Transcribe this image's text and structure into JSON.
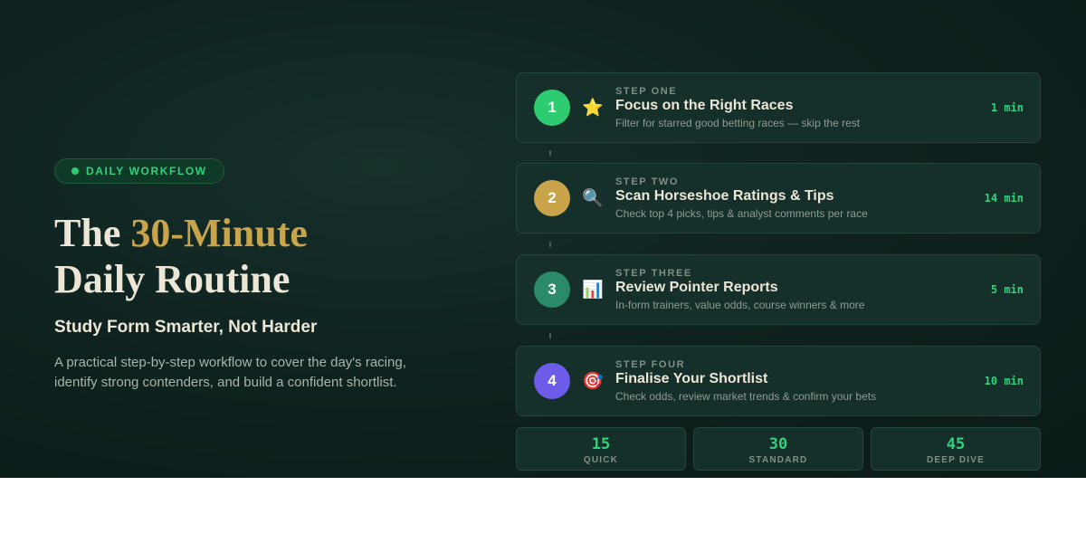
{
  "badge": {
    "label": "DAILY WORKFLOW"
  },
  "hero": {
    "title_pre": "The ",
    "title_accent": "30-Minute",
    "title_line2": "Daily Routine",
    "subtitle": "Study Form Smarter, Not Harder",
    "description": "A practical step-by-step workflow to cover the day's racing, identify strong contenders, and build a confident shortlist."
  },
  "steps": [
    {
      "number": "1",
      "label": "STEP ONE",
      "title": "Focus on the Right Races",
      "description": "Filter for starred good betting races — skip the rest",
      "time": "1 min",
      "icon": "star-icon",
      "emoji": "⭐",
      "color": "#2ecc71"
    },
    {
      "number": "2",
      "label": "STEP TWO",
      "title": "Scan Horseshoe Ratings & Tips",
      "description": "Check top 4 picks, tips & analyst comments per race",
      "time": "14 min",
      "icon": "magnifier-icon",
      "emoji": "🔍",
      "color": "#c9a44a"
    },
    {
      "number": "3",
      "label": "STEP THREE",
      "title": "Review Pointer Reports",
      "description": "In-form trainers, value odds, course winners & more",
      "time": "5 min",
      "icon": "bar-chart-icon",
      "emoji": "📊",
      "color": "#2a8a6a"
    },
    {
      "number": "4",
      "label": "STEP FOUR",
      "title": "Finalise Your Shortlist",
      "description": "Check odds, review market trends & confirm your bets",
      "time": "10 min",
      "icon": "target-icon",
      "emoji": "🎯",
      "color": "#6c5ce7"
    }
  ],
  "stats": [
    {
      "value": "15",
      "label": "QUICK"
    },
    {
      "value": "30",
      "label": "STANDARD"
    },
    {
      "value": "45",
      "label": "DEEP DIVE"
    }
  ],
  "colors": {
    "accent_green": "#34d17b",
    "accent_gold": "#c9a44a",
    "background": "#0f2320"
  }
}
